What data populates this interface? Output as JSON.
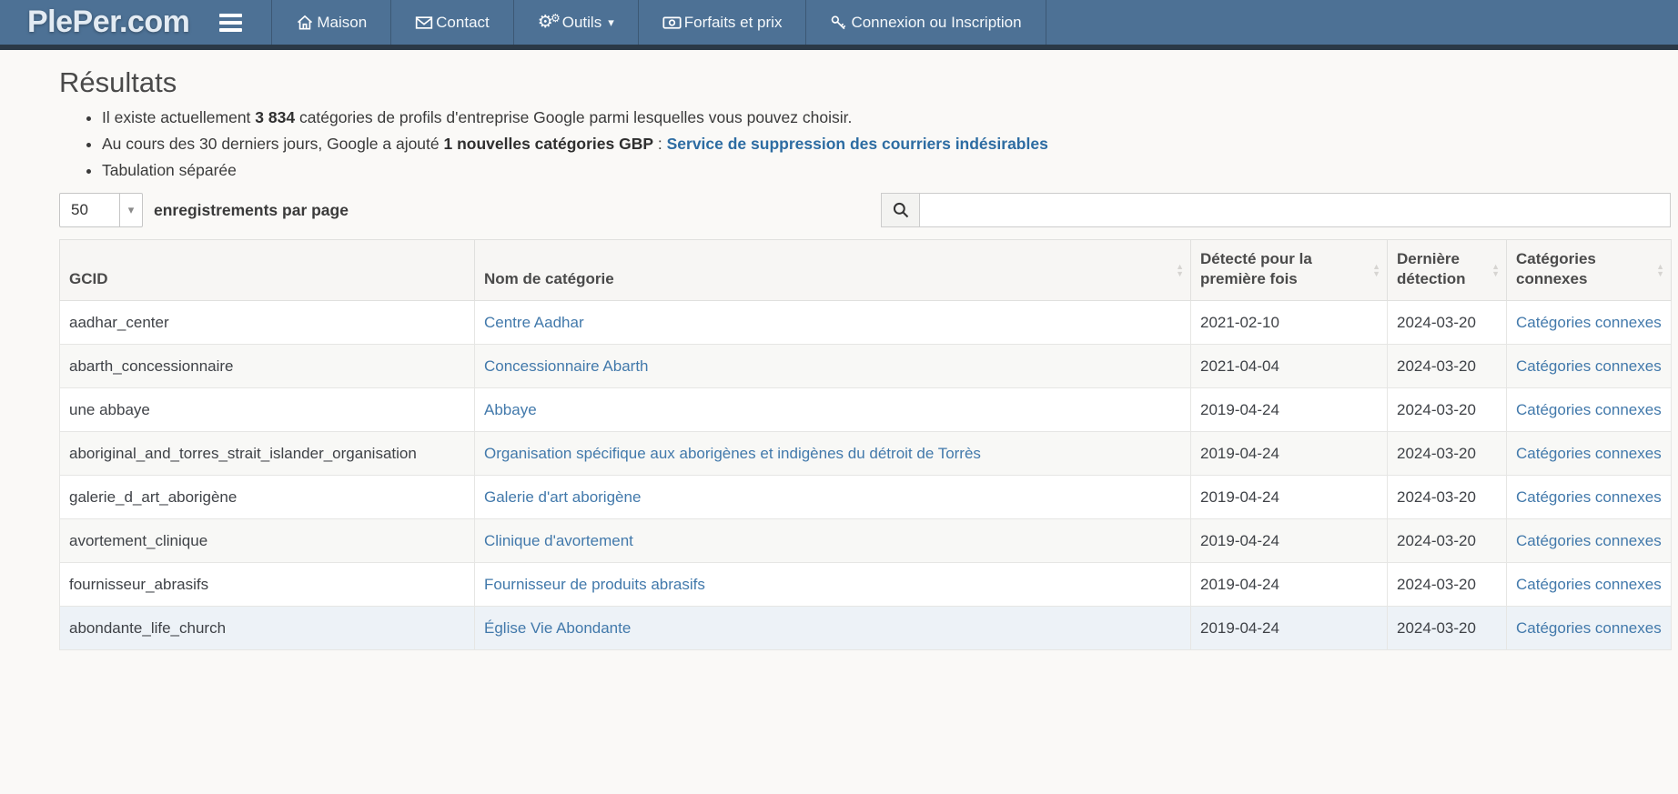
{
  "brand": "PlePer.com",
  "nav": {
    "items": [
      {
        "label": "Maison",
        "icon": "home-icon"
      },
      {
        "label": "Contact",
        "icon": "envelope-icon"
      },
      {
        "label": "Outils",
        "icon": "gears-icon",
        "has_dropdown": true
      },
      {
        "label": "Forfaits et prix",
        "icon": "money-icon"
      },
      {
        "label": "Connexion ou Inscription",
        "icon": "key-icon"
      }
    ]
  },
  "page": {
    "title": "Résultats"
  },
  "intro": {
    "total": {
      "pre": "Il existe actuellement ",
      "count": "3 834",
      "post": " catégories de profils d'entreprise Google parmi lesquelles vous pouvez choisir."
    },
    "recent": {
      "pre": "Au cours des 30 derniers jours, Google a ajouté ",
      "bold": "1 nouvelles catégories GBP",
      "sep": " : ",
      "link": "Service de suppression des courriers indésirables"
    },
    "tab_separated": "Tabulation séparée"
  },
  "controls": {
    "page_length": {
      "value": "50",
      "label": "enregistrements par page"
    },
    "search": {
      "value": ""
    }
  },
  "table": {
    "columns": [
      {
        "label": "GCID"
      },
      {
        "label": "Nom de catégorie"
      },
      {
        "label": "Détecté pour la première fois"
      },
      {
        "label": "Dernière détection"
      },
      {
        "label": "Catégories connexes"
      }
    ],
    "rows": [
      {
        "gcid": "aadhar_center",
        "name": "Centre Aadhar",
        "first_detected": "2021-02-10",
        "last_detected": "2024-03-20",
        "related": "Catégories connexes"
      },
      {
        "gcid": "abarth_concessionnaire",
        "name": "Concessionnaire Abarth",
        "first_detected": "2021-04-04",
        "last_detected": "2024-03-20",
        "related": "Catégories connexes"
      },
      {
        "gcid": "une abbaye",
        "name": "Abbaye",
        "first_detected": "2019-04-24",
        "last_detected": "2024-03-20",
        "related": "Catégories connexes"
      },
      {
        "gcid": "aboriginal_and_torres_strait_islander_organisation",
        "name": "Organisation spécifique aux aborigènes et indigènes du détroit de Torrès",
        "first_detected": "2019-04-24",
        "last_detected": "2024-03-20",
        "related": "Catégories connexes"
      },
      {
        "gcid": "galerie_d_art_aborigène",
        "name": "Galerie d'art aborigène",
        "first_detected": "2019-04-24",
        "last_detected": "2024-03-20",
        "related": "Catégories connexes"
      },
      {
        "gcid": "avortement_clinique",
        "name": "Clinique d'avortement",
        "first_detected": "2019-04-24",
        "last_detected": "2024-03-20",
        "related": "Catégories connexes"
      },
      {
        "gcid": "fournisseur_abrasifs",
        "name": "Fournisseur de produits abrasifs",
        "first_detected": "2019-04-24",
        "last_detected": "2024-03-20",
        "related": "Catégories connexes"
      },
      {
        "gcid": "abondante_life_church",
        "name": "Église Vie Abondante",
        "first_detected": "2019-04-24",
        "last_detected": "2024-03-20",
        "related": "Catégories connexes"
      }
    ]
  },
  "icons": {
    "caret_down": "▾",
    "sort_up": "▲",
    "sort_down": "▼",
    "gear": "⚙"
  },
  "colors": {
    "navbar": "#4d7195",
    "navbar_border": "#2b3947",
    "link": "#4279ab",
    "bold_link": "#2d6ca2",
    "highlight_row": "#edf2f7"
  }
}
